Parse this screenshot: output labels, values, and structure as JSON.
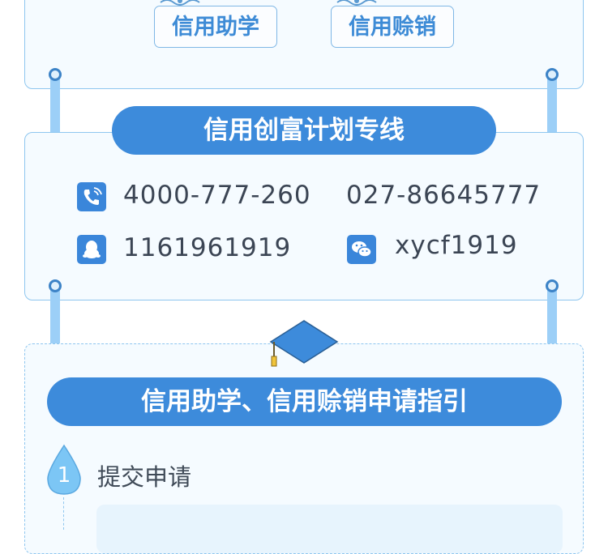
{
  "top_tags": [
    "信用助学",
    "信用赊销"
  ],
  "hotline": {
    "title": "信用创富计划专线",
    "phone_1": "4000-777-260",
    "phone_2": "027-86645777",
    "qq": "1161961919",
    "wechat": "xycf1919"
  },
  "guide": {
    "title": "信用助学、信用赊销申请指引",
    "steps": [
      {
        "number": "1",
        "label": "提交申请"
      }
    ]
  },
  "colors": {
    "accent": "#3d8bdb",
    "border": "#8ec6ef",
    "rail": "#9ccff7"
  },
  "icons": [
    "phone-icon",
    "qq-icon",
    "wechat-icon",
    "graduation-cap-icon",
    "water-drop-icon"
  ]
}
